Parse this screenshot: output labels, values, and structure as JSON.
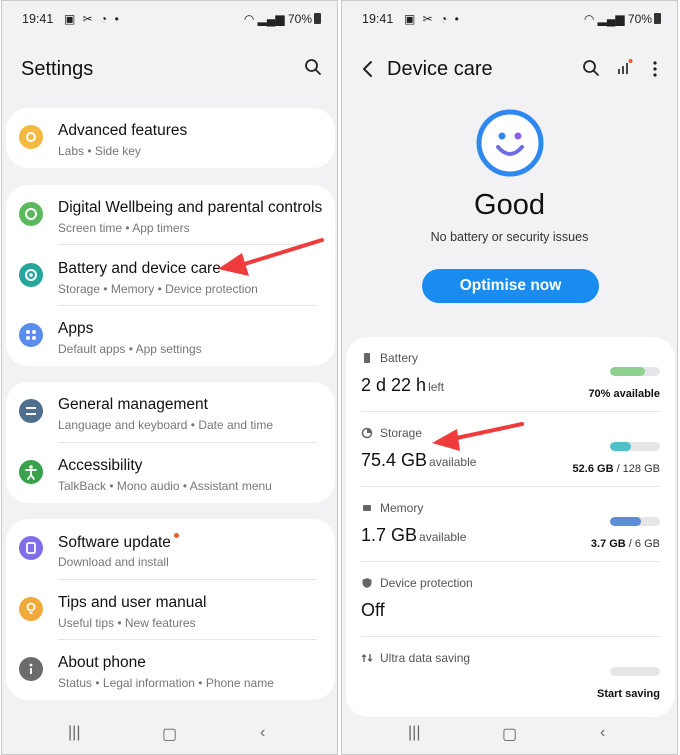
{
  "status_bar": {
    "time": "19:41",
    "battery": "70%"
  },
  "left": {
    "title": "Settings",
    "groups": [
      {
        "items": [
          {
            "title": "Advanced features",
            "sub": "Labs  •  Side key",
            "color": "#f5b942"
          }
        ]
      },
      {
        "items": [
          {
            "title": "Digital Wellbeing and parental controls",
            "sub": "Screen time  •  App timers",
            "color": "#5cb85c"
          },
          {
            "title": "Battery and device care",
            "sub": "Storage  •  Memory  •  Device protection",
            "color": "#26a69a"
          },
          {
            "title": "Apps",
            "sub": "Default apps  •  App settings",
            "color": "#5b8def"
          }
        ]
      },
      {
        "items": [
          {
            "title": "General management",
            "sub": "Language and keyboard  •  Date and time",
            "color": "#4f6f8f"
          },
          {
            "title": "Accessibility",
            "sub": "TalkBack  •  Mono audio  •  Assistant menu",
            "color": "#3aa14c"
          }
        ]
      },
      {
        "items": [
          {
            "title": "Software update",
            "sub": "Download and install",
            "color": "#7e6ee8"
          },
          {
            "title": "Tips and user manual",
            "sub": "Useful tips  •  New features",
            "color": "#f2a93b"
          },
          {
            "title": "About phone",
            "sub": "Status  •  Legal information  •  Phone name",
            "color": "#6b6b6b"
          }
        ]
      }
    ]
  },
  "right": {
    "title": "Device care",
    "status_word": "Good",
    "status_sub": "No battery or security issues",
    "optimise_label": "Optimise now",
    "metrics": {
      "battery": {
        "label": "Battery",
        "value": "2 d 22 h",
        "unit": "left",
        "right_bold": "70% available",
        "level": 0.7,
        "color": "#8fd28f"
      },
      "storage": {
        "label": "Storage",
        "value": "75.4 GB",
        "unit": "available",
        "right_bold": "52.6 GB",
        "right_rest": " / 128 GB",
        "level": 0.41,
        "color": "#4ec0c9"
      },
      "memory": {
        "label": "Memory",
        "value": "1.7 GB",
        "unit": "available",
        "right_bold": "3.7 GB",
        "right_rest": " / 6 GB",
        "level": 0.62,
        "color": "#5b8dd9"
      },
      "protection": {
        "label": "Device protection",
        "value": "Off"
      },
      "ultra": {
        "label": "Ultra data saving",
        "right_bold": "Start saving"
      }
    }
  }
}
